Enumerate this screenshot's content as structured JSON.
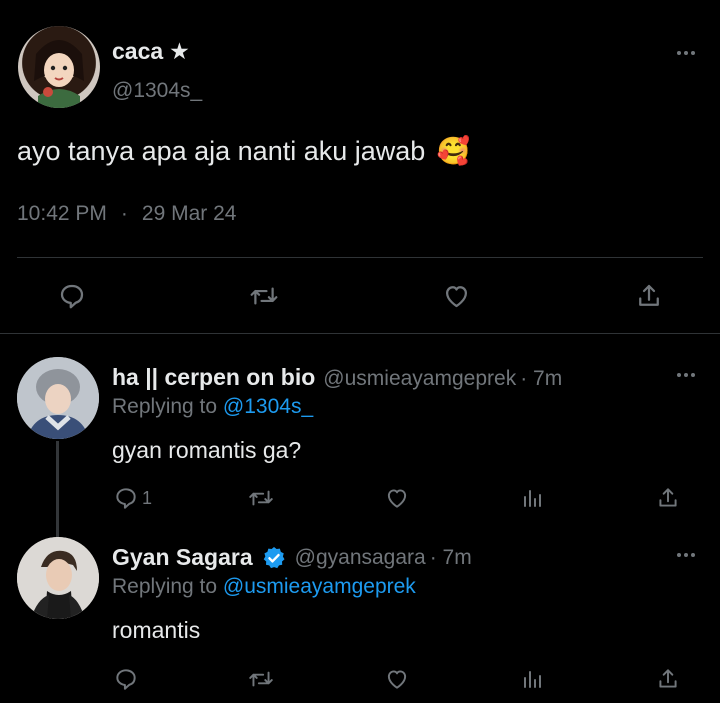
{
  "main_tweet": {
    "display_name": "caca",
    "name_star": "★",
    "handle": "@1304s_",
    "text": "ayo tanya apa aja nanti aku jawab",
    "emoji": "🥰",
    "time": "10:42 PM",
    "dot": "·",
    "date": "29 Mar 24",
    "icons": [
      "reply-icon",
      "retweet-icon",
      "like-icon",
      "share-icon"
    ]
  },
  "replies": [
    {
      "display_name": "ha || cerpen on bio",
      "handle": "@usmieayamgeprek",
      "age": "· 7m",
      "replying_prefix": "Replying to",
      "replying_to": "@1304s_",
      "text": "gyan romantis ga?",
      "reply_count": "1"
    },
    {
      "display_name": "Gyan Sagara",
      "handle": "@gyansagara",
      "age": "· 7m",
      "replying_prefix": "Replying to",
      "replying_to": "@usmieayamgeprek",
      "text": "romantis",
      "reply_count": ""
    }
  ],
  "colors": {
    "background": "#000000",
    "text": "#e7e9ea",
    "muted": "#71767b",
    "link": "#1d9bf0",
    "verified": "#1d9bf0",
    "divider": "#2f3336"
  }
}
